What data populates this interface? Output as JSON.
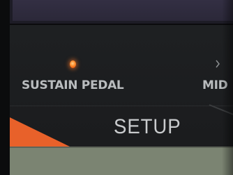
{
  "panel": {
    "sustain_label": "SUSTAIN PEDAL",
    "midi_label": "MID",
    "setup_label": "SETUP",
    "sustain_led_state": "on",
    "midi_led_state": "off"
  },
  "colors": {
    "led_on": "#ff7a22",
    "accent_orange": "#e8612a",
    "label_text": "#b9bcbe",
    "lcd": "#2e2b3d",
    "green_strip": "#7b8472"
  }
}
